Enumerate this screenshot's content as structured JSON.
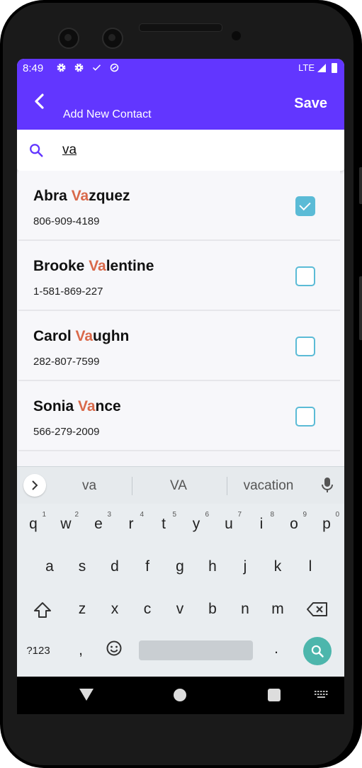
{
  "status_bar": {
    "time": "8:49",
    "network": "LTE",
    "icons": [
      "gear-icon",
      "gear-icon",
      "check-icon",
      "sync-icon"
    ]
  },
  "app_bar": {
    "title": "Add New Contact",
    "save_label": "Save",
    "color": "#6236ff"
  },
  "search": {
    "value": "va"
  },
  "contacts": [
    {
      "name_before": "Abra ",
      "name_highlight": "Va",
      "name_after": "zquez",
      "phone": "806-909-4189",
      "checked": true
    },
    {
      "name_before": "Brooke ",
      "name_highlight": "Va",
      "name_after": "lentine",
      "phone": "1-581-869-227",
      "checked": false
    },
    {
      "name_before": "Carol ",
      "name_highlight": "Va",
      "name_after": "ughn",
      "phone": "282-807-7599",
      "checked": false
    },
    {
      "name_before": "Sonia ",
      "name_highlight": "Va",
      "name_after": "nce",
      "phone": "566-279-2009",
      "checked": false
    }
  ],
  "highlight_color": "#d9694a",
  "checkbox_color": "#5bbbd6",
  "keyboard": {
    "suggestions": [
      "va",
      "VA",
      "vacation"
    ],
    "row1": [
      {
        "k": "q",
        "n": "1"
      },
      {
        "k": "w",
        "n": "2"
      },
      {
        "k": "e",
        "n": "3"
      },
      {
        "k": "r",
        "n": "4"
      },
      {
        "k": "t",
        "n": "5"
      },
      {
        "k": "y",
        "n": "6"
      },
      {
        "k": "u",
        "n": "7"
      },
      {
        "k": "i",
        "n": "8"
      },
      {
        "k": "o",
        "n": "9"
      },
      {
        "k": "p",
        "n": "0"
      }
    ],
    "row2": [
      "a",
      "s",
      "d",
      "f",
      "g",
      "h",
      "j",
      "k",
      "l"
    ],
    "row3": [
      "z",
      "x",
      "c",
      "v",
      "b",
      "n",
      "m"
    ],
    "symbols_label": "?123",
    "comma_label": ",",
    "period_label": ".",
    "enter_color": "#4db6ac"
  }
}
